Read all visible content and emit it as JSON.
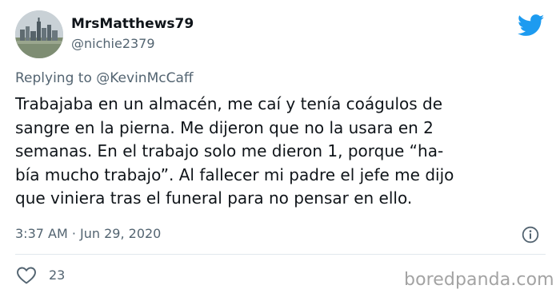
{
  "user": {
    "display_name": "MrsMatthews79",
    "handle": "@nichie2379",
    "avatar_icon": "city-skyline-avatar"
  },
  "platform_icon": "twitter-bird-icon",
  "colors": {
    "brand_blue": "#1d9bf0",
    "secondary_text": "#536471",
    "primary_text": "#0f1419"
  },
  "reply": {
    "prefix": "Replying to",
    "mention": "@KevinMcCaff"
  },
  "tweet": {
    "lines": [
      "Trabajaba en un almacén, me caí y tenía coágulos de",
      "sangre en la pierna. Me dijeron que no la usara en 2",
      "semanas. En el trabajo solo me dieron 1, porque “ha-",
      "bía mucho trabajo”. Al fallecer mi padre el jefe me dijo",
      "que viniera tras el funeral para no pensar en ello."
    ],
    "timestamp": "3:37 AM · Jun 29, 2020"
  },
  "actions": {
    "like_count": "23",
    "like_icon": "heart-icon",
    "info_icon": "info-icon"
  },
  "watermark": "boredpanda.com"
}
